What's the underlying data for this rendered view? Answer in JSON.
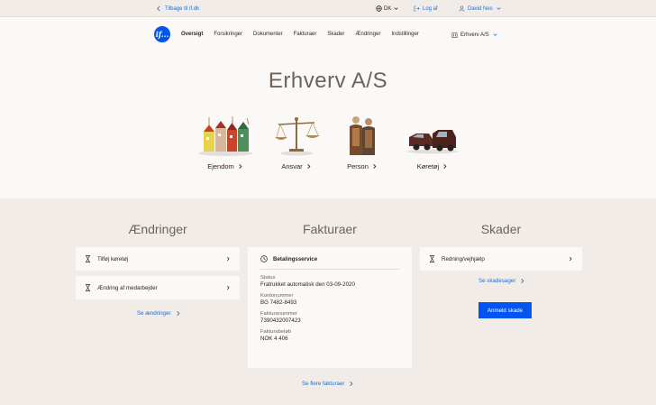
{
  "topbar": {
    "back_label": "Tilbage til if.dk",
    "language": "DK",
    "logout_label": "Log af",
    "user_name": "David Nes"
  },
  "nav": {
    "logo_text": "if...",
    "items": [
      "Oversigt",
      "Forsikringer",
      "Dokumenter",
      "Fakturaer",
      "Skader",
      "Ændringer",
      "Indstillinger"
    ],
    "active_index": 0,
    "company": "Erhverv A/S"
  },
  "hero": {
    "title": "Erhverv A/S",
    "categories": [
      {
        "label": "Ejendom"
      },
      {
        "label": "Ansvar"
      },
      {
        "label": "Person"
      },
      {
        "label": "Køretøj"
      }
    ]
  },
  "changes": {
    "title": "Ændringer",
    "items": [
      {
        "label": "Tilføj køretøj"
      },
      {
        "label": "Ændring af medarbejder"
      }
    ],
    "more_link": "Se ændringer"
  },
  "invoices": {
    "title": "Fakturaer",
    "card_title": "Betalingsservice",
    "status_label": "Status",
    "status_value": "Fratrukket automatisk den 03-09-2020",
    "account_label": "Kontonummer",
    "account_value": "BG 7482-8493",
    "invoice_no_label": "Fakturanummer",
    "invoice_no_value": "7390432007423",
    "amount_label": "Fakturabeløb",
    "amount_value": "NOK 4 406",
    "more_link": "Se flere fakturaer"
  },
  "claims": {
    "title": "Skader",
    "items": [
      {
        "label": "Redning/vejhjælp"
      }
    ],
    "more_link": "Se skadesager",
    "report_button": "Anmeld skade"
  },
  "colors": {
    "accent": "#0054f0",
    "link": "#1c6fd6",
    "text": "#331e11",
    "beige": "#f1ece8"
  }
}
